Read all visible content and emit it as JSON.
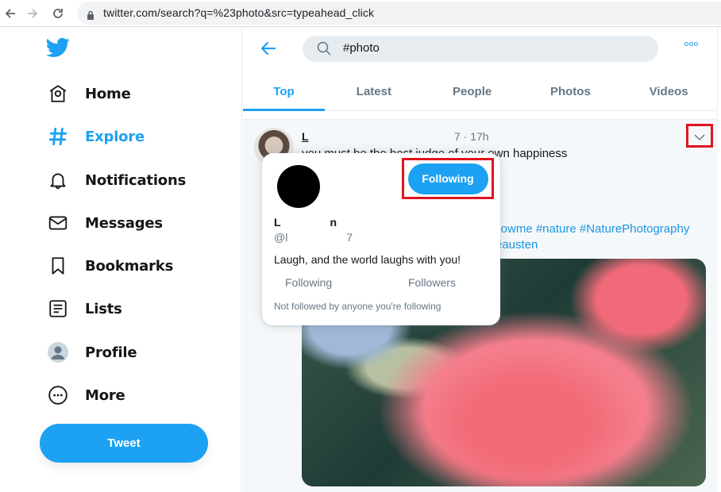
{
  "browser": {
    "url": "twitter.com/search?q=%23photo&src=typeahead_click",
    "icons": {
      "back": "arrow-left-icon",
      "forward": "arrow-right-icon",
      "reload": "reload-icon",
      "secure": "lock-icon"
    }
  },
  "sidebar": {
    "logo": "twitter-bird-icon",
    "items": [
      {
        "label": "Home",
        "icon": "home-icon",
        "active": false
      },
      {
        "label": "Explore",
        "icon": "hashtag-icon",
        "active": true
      },
      {
        "label": "Notifications",
        "icon": "bell-icon",
        "active": false
      },
      {
        "label": "Messages",
        "icon": "envelope-icon",
        "active": false
      },
      {
        "label": "Bookmarks",
        "icon": "bookmark-icon",
        "active": false
      },
      {
        "label": "Lists",
        "icon": "list-icon",
        "active": false
      },
      {
        "label": "Profile",
        "icon": "avatar-icon",
        "active": false
      },
      {
        "label": "More",
        "icon": "more-circle-icon",
        "active": false
      }
    ],
    "tweet_button": "Tweet"
  },
  "header": {
    "search_query": "#photo",
    "tabs": [
      {
        "label": "Top",
        "active": true
      },
      {
        "label": "Latest",
        "active": false
      },
      {
        "label": "People",
        "active": false
      },
      {
        "label": "Photos",
        "active": false
      },
      {
        "label": "Videos",
        "active": false
      }
    ]
  },
  "tweet": {
    "author_name": "L",
    "meta": "7 · 17h",
    "text": "you must be the best judge of your own happiness",
    "hashtags_line1": "llowme #nature #NaturePhotography",
    "hashtags_line2": "eausten"
  },
  "hovercard": {
    "name": "L                n",
    "handle": "@l                   7",
    "follow_button": "Following",
    "bio": "Laugh, and the world laughs with you!",
    "following_label": "Following",
    "followers_label": "Followers",
    "note": "Not followed by anyone you're following"
  },
  "colors": {
    "accent": "#1da1f2",
    "annotation_red": "#e0141e",
    "text_secondary": "#657786"
  }
}
